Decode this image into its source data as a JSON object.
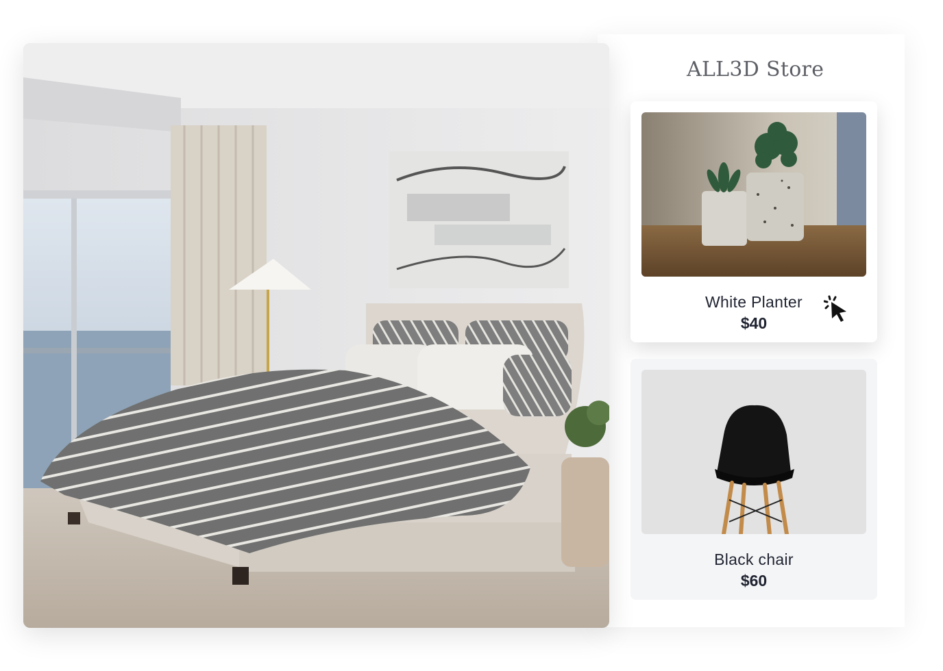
{
  "store": {
    "title": "ALL3D Store"
  },
  "products": [
    {
      "name": "White Planter",
      "price": "$40",
      "image_icon": "planter-photo",
      "hovered": true
    },
    {
      "name": "Black chair",
      "price": "$60",
      "image_icon": "chair-photo",
      "hovered": false
    }
  ],
  "scene": {
    "image_icon": "bedroom-render"
  },
  "cursor": {
    "icon": "pointer-click-icon"
  },
  "colors": {
    "title": "#5d5f66",
    "text": "#1f2330",
    "card_active_bg": "#ffffff",
    "card_idle_bg": "#f4f5f7"
  }
}
